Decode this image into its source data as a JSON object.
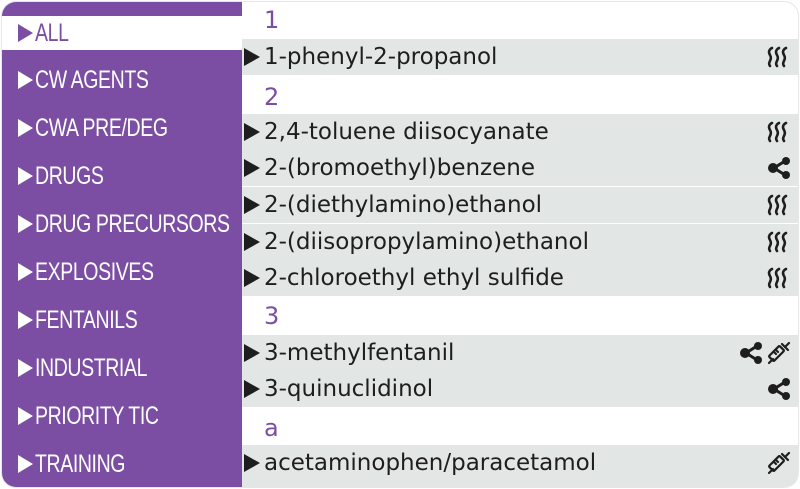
{
  "sidebar": {
    "items": [
      {
        "label": "ALL",
        "active": true
      },
      {
        "label": "CW AGENTS"
      },
      {
        "label": "CWA PRE/DEG"
      },
      {
        "label": "DRUGS"
      },
      {
        "label": "DRUG PRECURSORS"
      },
      {
        "label": "EXPLOSIVES"
      },
      {
        "label": "FENTANILS"
      },
      {
        "label": "INDUSTRIAL"
      },
      {
        "label": "PRIORITY TIC"
      },
      {
        "label": "TRAINING"
      }
    ]
  },
  "list": {
    "headers": [
      "1",
      "2",
      "3",
      "a"
    ],
    "rows": [
      {
        "name": "1-phenyl-2-propanol",
        "icons": [
          "heat-wave-icon"
        ]
      },
      {
        "name": "2,4-toluene diisocyanate",
        "icons": [
          "heat-wave-icon"
        ]
      },
      {
        "name": "2-(bromoethyl)benzene",
        "icons": [
          "molecule-icon"
        ]
      },
      {
        "name": "2-(diethylamino)ethanol",
        "icons": [
          "heat-wave-icon"
        ]
      },
      {
        "name": "2-(diisopropylamino)ethanol",
        "icons": [
          "heat-wave-icon"
        ]
      },
      {
        "name": "2-chloroethyl ethyl sulfide",
        "icons": [
          "heat-wave-icon"
        ]
      },
      {
        "name": "3-methylfentanil",
        "icons": [
          "molecule-icon",
          "syringe-icon"
        ]
      },
      {
        "name": "3-quinuclidinol",
        "icons": [
          "molecule-icon"
        ]
      },
      {
        "name": "acetaminophen/paracetamol",
        "icons": [
          "syringe-icon"
        ]
      }
    ]
  },
  "colors": {
    "accent": "#7b4ea3",
    "row_background": "#e2e6e5",
    "text": "#1e1e1e"
  }
}
